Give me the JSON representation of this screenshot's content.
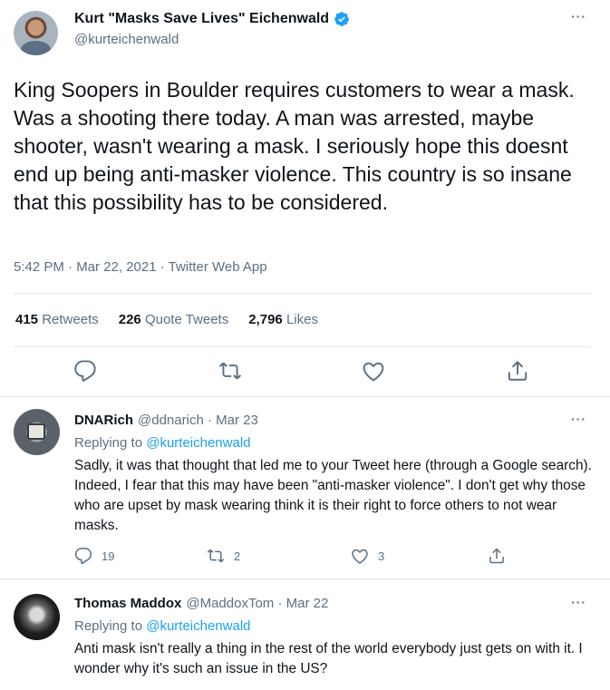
{
  "main_tweet": {
    "display_name": "Kurt \"Masks Save Lives\" Eichenwald",
    "handle": "@kurteichenwald",
    "text": "King Soopers in Boulder requires customers to wear a mask. Was a shooting there today. A man was arrested, maybe shooter, wasn't wearing a mask. I seriously hope this doesnt end up being anti-masker violence. This country is so insane that this possibility has to be considered.",
    "meta": "5:42 PM · Mar 22, 2021 · Twitter Web App",
    "retweets_count": "415",
    "retweets_label": "Retweets",
    "quote_count": "226",
    "quote_label": "Quote Tweets",
    "likes_count": "2,796",
    "likes_label": "Likes"
  },
  "replies": [
    {
      "display_name": "DNARich",
      "handle_date": "@ddnarich · Mar 23",
      "replying_prefix": "Replying to",
      "replying_to": "@kurteichenwald",
      "text": "Sadly, it was that thought that led me to your Tweet here (through a Google search). Indeed, I fear that this may have been \"anti-masker violence\". I don't get why those who are upset by mask wearing think it is their right to force others to not wear masks.",
      "reply_count": "19",
      "retweet_count": "2",
      "like_count": "3"
    },
    {
      "display_name": "Thomas Maddox",
      "handle_date": "@MaddoxTom · Mar 22",
      "replying_prefix": "Replying to",
      "replying_to": "@kurteichenwald",
      "text": "Anti mask isn't really a thing in the rest of the world everybody just gets on with it. I wonder why it's such an issue in the US?"
    }
  ],
  "colors": {
    "accent": "#1da1f2",
    "secondary_text": "#5b7083",
    "divider": "#e1e8ed"
  },
  "icons": [
    "more-icon",
    "verified-badge-icon",
    "reply-icon",
    "retweet-icon",
    "like-icon",
    "share-icon"
  ]
}
